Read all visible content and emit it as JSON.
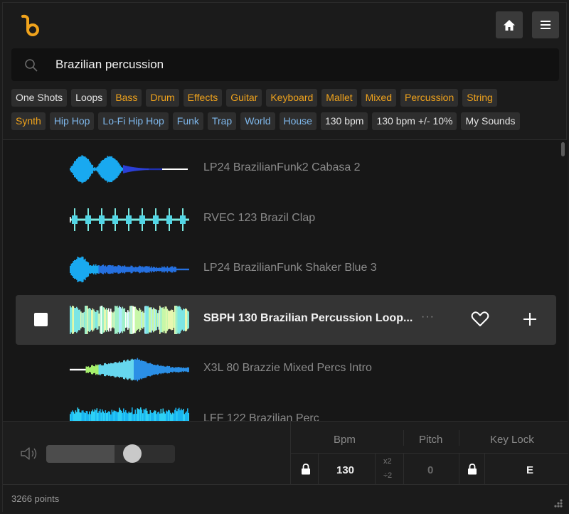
{
  "header": {
    "logo_icon": "b-note-logo-icon",
    "home_icon": "home-icon",
    "menu_icon": "hamburger-menu-icon",
    "accent_color": "#f0a31c"
  },
  "search": {
    "icon": "search-icon",
    "value": "Brazilian percussion"
  },
  "tags": {
    "row1": [
      {
        "label": "One Shots",
        "color": "white"
      },
      {
        "label": "Loops",
        "color": "white"
      },
      {
        "label": "Bass",
        "color": "orange"
      },
      {
        "label": "Drum",
        "color": "orange"
      },
      {
        "label": "Effects",
        "color": "orange"
      },
      {
        "label": "Guitar",
        "color": "orange"
      },
      {
        "label": "Keyboard",
        "color": "orange"
      },
      {
        "label": "Mallet",
        "color": "orange"
      },
      {
        "label": "Mixed",
        "color": "orange"
      },
      {
        "label": "Percussion",
        "color": "orange"
      },
      {
        "label": "String",
        "color": "orange"
      }
    ],
    "row2": [
      {
        "label": "Synth",
        "color": "orange"
      },
      {
        "label": "Hip Hop",
        "color": "blue"
      },
      {
        "label": "Lo-Fi Hip Hop",
        "color": "blue"
      },
      {
        "label": "Funk",
        "color": "blue"
      },
      {
        "label": "Trap",
        "color": "blue"
      },
      {
        "label": "World",
        "color": "blue"
      },
      {
        "label": "House",
        "color": "blue"
      },
      {
        "label": "130 bpm",
        "color": "white"
      },
      {
        "label": "130 bpm +/- 10%",
        "color": "white"
      },
      {
        "label": "My Sounds",
        "color": "white"
      }
    ]
  },
  "results": [
    {
      "title": "LP24 BrazilianFunk2 Cabasa 2",
      "waveform": "cabasa",
      "selected": false
    },
    {
      "title": "RVEC 123 Brazil Clap",
      "waveform": "clap",
      "selected": false
    },
    {
      "title": "LP24 BrazilianFunk Shaker Blue 3",
      "waveform": "shaker",
      "selected": false
    },
    {
      "title": "SBPH 130 Brazilian Percussion Loop...",
      "waveform": "loop",
      "selected": true
    },
    {
      "title": "X3L 80 Brazzie Mixed Percs Intro",
      "waveform": "intro",
      "selected": false
    },
    {
      "title": "LFF 122 Brazilian Perc",
      "waveform": "perc",
      "selected": false
    }
  ],
  "row_actions": {
    "more_label": "···",
    "heart_icon": "heart-icon",
    "add_icon": "plus-icon"
  },
  "player": {
    "volume_icon": "speaker-icon",
    "volume_level": 0.67,
    "bpm_label": "Bpm",
    "pitch_label": "Pitch",
    "keylock_label": "Key Lock",
    "bpm_value": "130",
    "bpm_multiplier_up": "x2",
    "bpm_multiplier_down": "÷2",
    "pitch_value": "0",
    "key_value": "E",
    "lock_icon": "lock-icon"
  },
  "footer": {
    "points": "3266 points",
    "grip_icon": "resize-grip-icon"
  }
}
